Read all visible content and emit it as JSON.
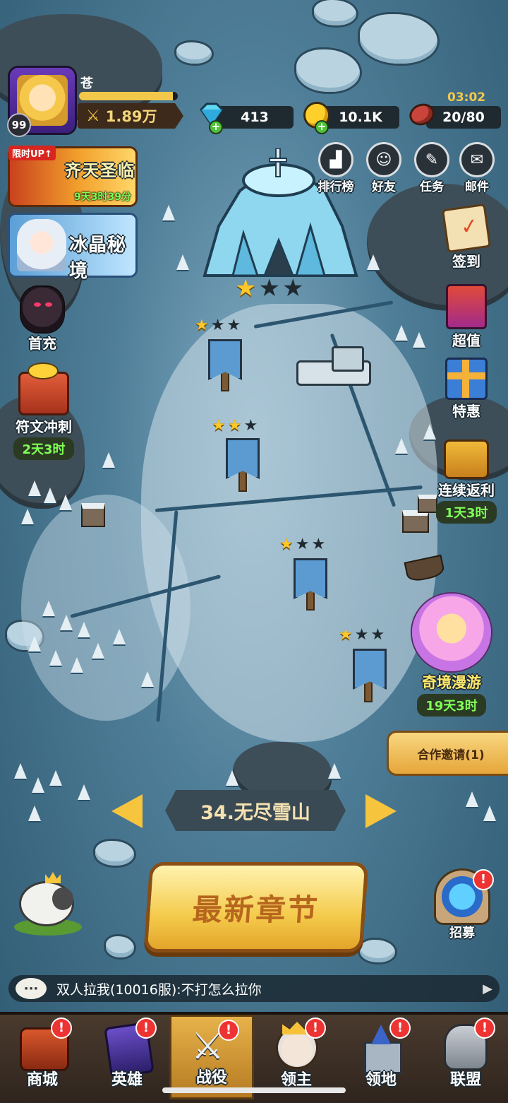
{
  "player": {
    "name": "苍",
    "level": "99",
    "power": "1.89万"
  },
  "resources": {
    "gems": "413",
    "gold": "10.1K",
    "stamina": "20/80",
    "stamina_timer": "03:02"
  },
  "top_menu": [
    {
      "label": "排行榜",
      "icon": "ranking-icon"
    },
    {
      "label": "好友",
      "icon": "friends-icon"
    },
    {
      "label": "任务",
      "icon": "quest-icon"
    },
    {
      "label": "邮件",
      "icon": "mail-icon"
    }
  ],
  "left_events": {
    "limited_tag": "限时UP↑",
    "event1_title": "齐天圣临",
    "event1_timer": "9天3时39分",
    "event2_title": "冰晶秘境",
    "first_charge": "首充",
    "rune_rush": "符文冲刺",
    "rune_timer": "2天3时"
  },
  "right_menu": {
    "signin": "签到",
    "value": "超值",
    "special": "特惠",
    "rebate": "连续返利",
    "rebate_timer": "1天3时",
    "wonderland": "奇境漫游",
    "wonderland_timer": "19天3时",
    "coop_invite": "合作邀请(1)",
    "recruit": "招募"
  },
  "chapter": {
    "title": "34.无尽雪山",
    "button": "最新章节"
  },
  "stages": [
    {
      "stars": 1
    },
    {
      "stars": 2
    },
    {
      "stars": 1
    },
    {
      "stars": 1
    },
    {
      "stars": 1
    }
  ],
  "chat": {
    "message": "双人拉我(10016服):不打怎么拉你"
  },
  "bottom_nav": [
    {
      "label": "商城",
      "badge": "!"
    },
    {
      "label": "英雄",
      "badge": "!"
    },
    {
      "label": "战役",
      "badge": "!",
      "active": true
    },
    {
      "label": "领主",
      "badge": "!"
    },
    {
      "label": "领地",
      "badge": "!"
    },
    {
      "label": "联盟",
      "badge": "!"
    }
  ],
  "colors": {
    "accent_gold": "#f2c84b",
    "timer_green": "#7fff58",
    "badge_red": "#e33333",
    "nav_bg": "#3b2f28"
  }
}
